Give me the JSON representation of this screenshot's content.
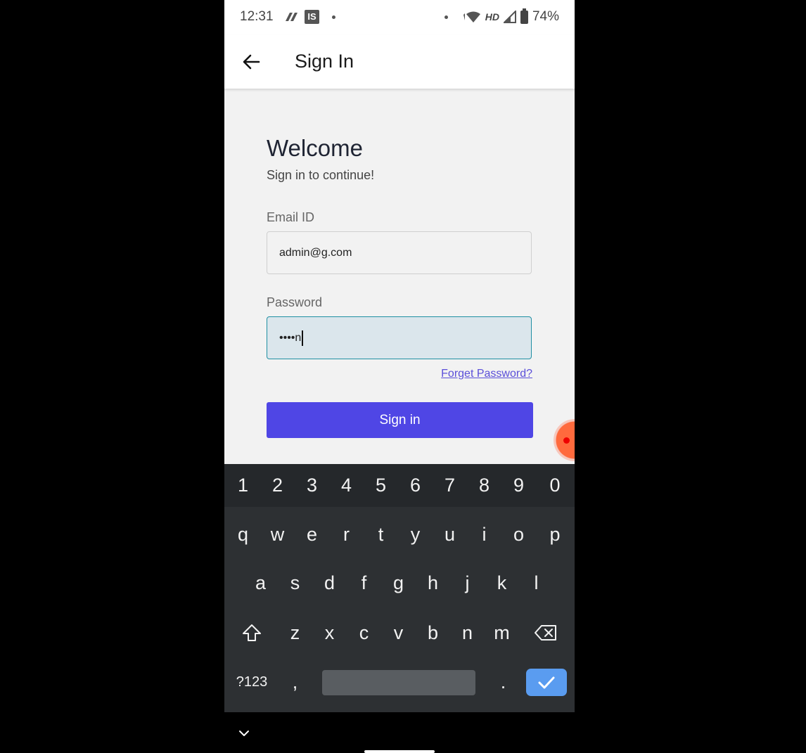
{
  "status_bar": {
    "time": "12:31",
    "app_icon_label": "IS",
    "network": "HD",
    "battery": "74%"
  },
  "app_bar": {
    "title": "Sign In",
    "back_icon": "arrow-left-icon"
  },
  "form": {
    "welcome": "Welcome",
    "subtitle": "Sign in to continue!",
    "email_label": "Email ID",
    "email_value": "admin@g.com",
    "password_label": "Password",
    "password_value": "••••n",
    "forgot_link": "Forget Password?",
    "signin_label": "Sign in"
  },
  "keyboard": {
    "number_row": [
      "1",
      "2",
      "3",
      "4",
      "5",
      "6",
      "7",
      "8",
      "9",
      "0"
    ],
    "row1": [
      "q",
      "w",
      "e",
      "r",
      "t",
      "y",
      "u",
      "i",
      "o",
      "p"
    ],
    "row2": [
      "a",
      "s",
      "d",
      "f",
      "g",
      "h",
      "j",
      "k",
      "l"
    ],
    "row3": [
      "z",
      "x",
      "c",
      "v",
      "b",
      "n",
      "m"
    ],
    "symbols_key": "?123",
    "comma_key": ",",
    "period_key": ".",
    "shift_icon": "shift-icon",
    "backspace_icon": "backspace-icon",
    "enter_icon": "checkmark-icon"
  },
  "nav_bar": {
    "chevron_icon": "chevron-down-icon"
  },
  "colors": {
    "primary": "#4f46e5",
    "link": "#5b4fd9",
    "focus_border": "#1f8fa3",
    "keyboard_bg": "#2d3033",
    "enter_key": "#5a9cf0"
  }
}
